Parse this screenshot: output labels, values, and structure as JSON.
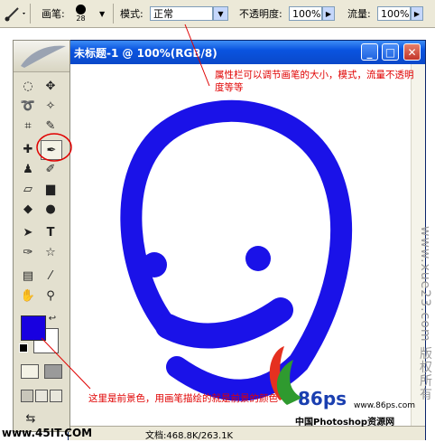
{
  "options_bar": {
    "brush_label": "画笔:",
    "brush_size": "28",
    "mode_label": "模式:",
    "mode_value": "正常",
    "opacity_label": "不透明度:",
    "opacity_value": "100%",
    "flow_label": "流量:",
    "flow_value": "100%"
  },
  "document": {
    "title": "未标题-1 @ 100%(RGB/8)",
    "status": "文档:468.8K/263.1K"
  },
  "annotations": {
    "top_note": "属性栏可以调节画笔的大小，模式，流量不透明度等等",
    "bottom_note": "这里是前景色，用画笔描绘的就是前景的颜色"
  },
  "colors": {
    "foreground": "#1800e0",
    "background": "#ffffff",
    "stroke": "#1a12e8",
    "annotation": "#e00000"
  },
  "watermarks": {
    "right_vertical": "www.xue23.com 版权所有",
    "bottom_left": "www.45IT.COM",
    "logo_text": "86ps",
    "logo_url": "www.86ps.com",
    "logo_cn": "中国Photoshop资源网"
  }
}
